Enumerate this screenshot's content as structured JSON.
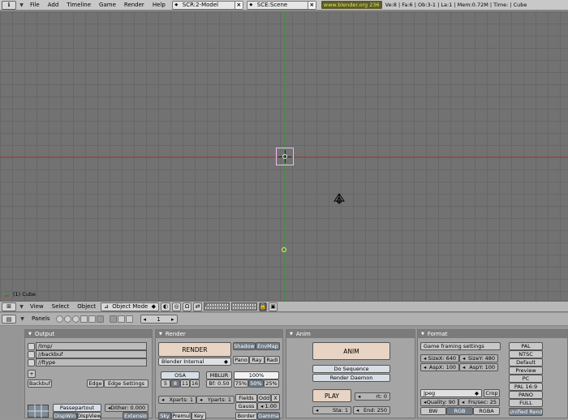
{
  "menubar": {
    "items": [
      "File",
      "Add",
      "Timeline",
      "Game",
      "Render",
      "Help"
    ],
    "screen": "SCR:2-Model",
    "scene": "SCE:Scene",
    "blender_link": "www.blender.org 236",
    "stats": "Ve:8 | Fa:6 | Ob:3-1 | La:1 | Mem:0.72M | Time: | Cube"
  },
  "viewport": {
    "object_label": "(1) Cube"
  },
  "header3d": {
    "menus": [
      "View",
      "Select",
      "Object"
    ],
    "mode": "Object Mode"
  },
  "buttons_header": {
    "panels_label": "Panels",
    "frame": "1"
  },
  "output_panel": {
    "title": "Output",
    "paths": [
      "/tmp/",
      "//backbuf",
      "//ftype"
    ],
    "backbuf": "Backbuf",
    "edge": "Edge",
    "edge_settings": "Edge Settings",
    "passepartout": "Passepartout",
    "dither": "Dither: 0.000",
    "dispwin": "DispWin",
    "dispview": "DispView",
    "extension": "Extensio"
  },
  "render_panel": {
    "title": "Render",
    "render": "RENDER",
    "shadow": "Shadow",
    "envmap": "EnvMap",
    "pano": "Pano",
    "ray": "Ray",
    "radio": "Radi",
    "engine": "Blender Internal",
    "osa": "OSA",
    "mblur": "MBLUR",
    "percent100": "100%",
    "osa_levels": [
      "5",
      "8",
      "11",
      "16"
    ],
    "bf": "Bf: 0.50",
    "percents": [
      "75%",
      "50%",
      "25%"
    ],
    "fields": "Fields",
    "odd": "Odd",
    "x": "X",
    "xparts": "Xparts: 1",
    "yparts": "Yparts: 1",
    "gauss": "Gauss",
    "gauss_val": "1.00",
    "sky": "Sky",
    "premul": "Premul",
    "key": "Key",
    "border": "Border",
    "gamma": "Gamma"
  },
  "anim_panel": {
    "title": "Anim",
    "anim": "ANIM",
    "do_sequence": "Do Sequence",
    "render_daemon": "Render Daemon",
    "play": "PLAY",
    "rt": "rt: 0",
    "sta": "Sta: 1",
    "end": "End: 250"
  },
  "format_panel": {
    "title": "Format",
    "game_framing": "Game framing settings",
    "sizex": "SizeX: 640",
    "sizey": "SizeY: 480",
    "aspx": "AspX: 100",
    "aspy": "AspY: 100",
    "jpeg": "Jpeg",
    "crop": "Crop",
    "quality": "Quality: 90",
    "frs": "Frs/sec: 25",
    "bw": "BW",
    "rgb": "RGB",
    "rgba": "RGBA",
    "presets": [
      "PAL",
      "NTSC",
      "Default",
      "Preview",
      "PC",
      "PAL 16:9",
      "PANO",
      "FULL",
      "Unified Rend"
    ]
  }
}
